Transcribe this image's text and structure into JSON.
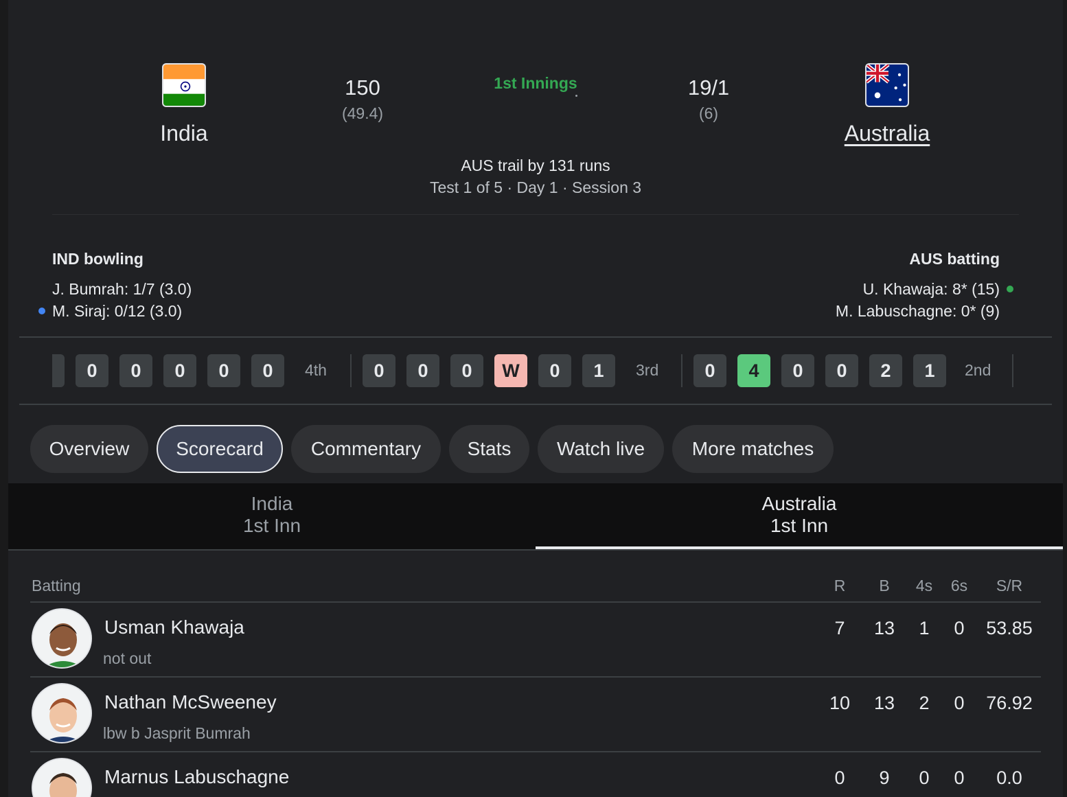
{
  "header": {
    "team1": {
      "name": "India",
      "runs": "150",
      "overs": "(49.4)"
    },
    "team2": {
      "name": "Australia",
      "runs": "19/1",
      "overs": "(6)"
    },
    "innings_label": "1st Innings",
    "trail_text": "AUS trail by 131 runs",
    "match_info": "Test 1 of 5 · Day 1 · Session 3"
  },
  "bowling": {
    "title": "IND bowling",
    "lines": [
      "J. Bumrah: 1/7 (3.0)",
      "M. Siraj: 0/12 (3.0)"
    ]
  },
  "batting_now": {
    "title": "AUS batting",
    "lines": [
      "U. Khawaja: 8* (15)",
      "M. Labuschagne: 0* (9)"
    ]
  },
  "overs": [
    {
      "label": "4th",
      "balls": [
        "0",
        "0",
        "0",
        "0",
        "0"
      ]
    },
    {
      "label": "3rd",
      "balls": [
        "0",
        "0",
        "0",
        "W",
        "0",
        "1"
      ]
    },
    {
      "label": "2nd",
      "balls": [
        "0",
        "4",
        "0",
        "0",
        "2",
        "1"
      ]
    }
  ],
  "tabs": [
    "Overview",
    "Scorecard",
    "Commentary",
    "Stats",
    "Watch live",
    "More matches"
  ],
  "innings_tabs": [
    {
      "team": "India",
      "inn": "1st Inn"
    },
    {
      "team": "Australia",
      "inn": "1st Inn"
    }
  ],
  "table": {
    "section": "Batting",
    "headers": [
      "R",
      "B",
      "4s",
      "6s",
      "S/R"
    ],
    "rows": [
      {
        "name": "Usman Khawaja",
        "dismissal": "not out",
        "stats": [
          "7",
          "13",
          "1",
          "0",
          "53.85"
        ]
      },
      {
        "name": "Nathan McSweeney",
        "dismissal": "lbw b Jasprit Bumrah",
        "stats": [
          "10",
          "13",
          "2",
          "0",
          "76.92"
        ]
      },
      {
        "name": "Marnus Labuschagne",
        "dismissal": "",
        "stats": [
          "0",
          "9",
          "0",
          "0",
          "0.0"
        ]
      }
    ]
  },
  "colors": {
    "innings_green": "#34a853",
    "wicket_ball": "#f5b7b1",
    "boundary_ball": "#5bc97d",
    "bowler_dot": "#4285f4",
    "batter_dot": "#34a853"
  }
}
